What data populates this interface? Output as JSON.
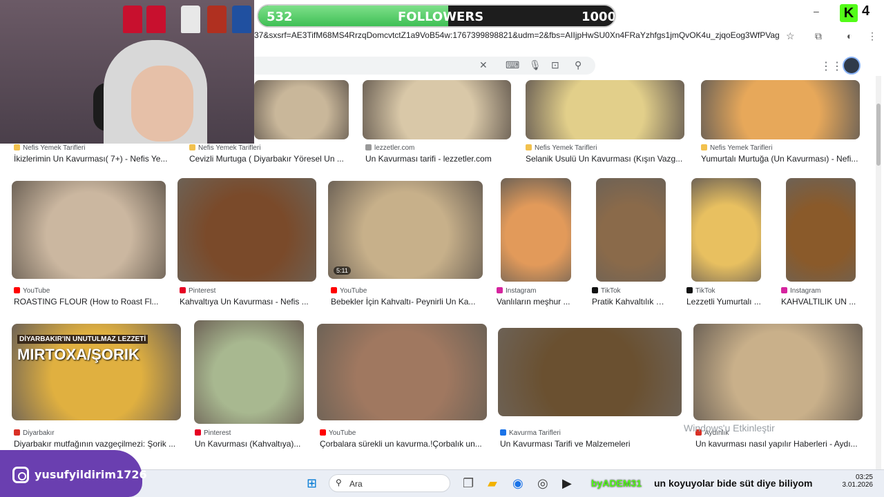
{
  "overlay": {
    "followers": {
      "current": "532",
      "label": "FOLLOWERS",
      "goal": "1000",
      "progress_fraction": 0.532
    },
    "kick_count": "4",
    "social_handle": "yusufyildirim1726"
  },
  "browser": {
    "url": "37&sxsrf=AE3TifM68MS4RrzqDomcvtctZ1a9VoB54w:1767399898821&udm=2&fbs=AIIjpHwSU0Xn4FRaYzhfgs1jmQvOK4u_zjqoEog3WfPVagxwZu...",
    "search_value": ""
  },
  "results": [
    {
      "source": "Nefis Yemek Tarifleri",
      "title": "İkizlerimin Un Kavurması( 7+) - Nefis Ye...",
      "color": "#f2c14e",
      "tone": "#c9b79a"
    },
    {
      "source": "Nefis Yemek Tarifleri",
      "title": "Cevizli Murtuga ( Diyarbakır Yöresel Un ...",
      "color": "#f2c14e",
      "tone": "#d8c4a0"
    },
    {
      "source": "lezzetler.com",
      "title": "Un Kavurması tarifi - lezzetler.com",
      "color": "#999999",
      "tone": "#d9c8a8"
    },
    {
      "source": "Nefis Yemek Tarifleri",
      "title": "Selanik Usulü Un Kavurması (Kışın Vazg...",
      "color": "#f2c14e",
      "tone": "#e2cf8a"
    },
    {
      "source": "Nefis Yemek Tarifleri",
      "title": "Yumurtalı Murtuğa (Un Kavurması) - Nefi...",
      "color": "#f2c14e",
      "tone": "#e7a85a"
    },
    {
      "source": "YouTube",
      "title": "ROASTING FLOUR (How to Roast Fl...",
      "color": "#ff0000",
      "tone": "#cbb7a0"
    },
    {
      "source": "Pinterest",
      "title": "Kahvaltıya Un Kavurması - Nefis ...",
      "color": "#e60023",
      "tone": "#7a4a2a"
    },
    {
      "source": "YouTube",
      "title": "Bebekler İçin Kahvaltı- Peynirli Un Ka...",
      "color": "#ff0000",
      "tone": "#c7b08a",
      "badge": "5:11"
    },
    {
      "source": "Instagram",
      "title": "Vanlıların meşhur ...",
      "color": "#d6249f",
      "tone": "#e29a5a"
    },
    {
      "source": "TikTok",
      "title": "Pratik Kahvaltılık U...",
      "color": "#111111",
      "tone": "#8a6a4a"
    },
    {
      "source": "TikTok",
      "title": "Lezzetli Yumurtalı ...",
      "color": "#111111",
      "tone": "#e8c060"
    },
    {
      "source": "Instagram",
      "title": "KAHVALTILIK UN ...",
      "color": "#d6249f",
      "tone": "#8a5a2a"
    },
    {
      "source": "Diyarbakır",
      "title": "Diyarbakır mutfağının vazgeçilmezi: Şorik ...",
      "color": "#d93025",
      "tone": "#e0b040",
      "overlay1": "DİYARBAKIR'IN UNUTULMAZ LEZZETİ",
      "overlay2": "MIRTOXA/ŞORIK"
    },
    {
      "source": "Pinterest",
      "title": "Un Kavurması (Kahvaltıya)...",
      "color": "#e60023",
      "tone": "#a8b890"
    },
    {
      "source": "YouTube",
      "title": "Çorbalara sürekli un kavurma.!Çorbalık un...",
      "color": "#ff0000",
      "tone": "#a07860"
    },
    {
      "source": "Kavurma Tarifleri",
      "title": "Un Kavurması Tarifi ve Malzemeleri",
      "color": "#1a73e8",
      "tone": "#6a5030"
    },
    {
      "source": "Aydınlık",
      "title": "Un kavurması nasıl yapılır Haberleri - Aydı...",
      "color": "#d93025",
      "tone": "#c9b08a"
    }
  ],
  "watermark": "Windows'u Etkinleştir",
  "taskbar": {
    "search_label": "Ara"
  },
  "chat": {
    "user": "byADEM31",
    "message": "un koyuyolar bide süt diye biliyom"
  },
  "clock": {
    "time": "03:25",
    "date": "3.01.2026"
  }
}
